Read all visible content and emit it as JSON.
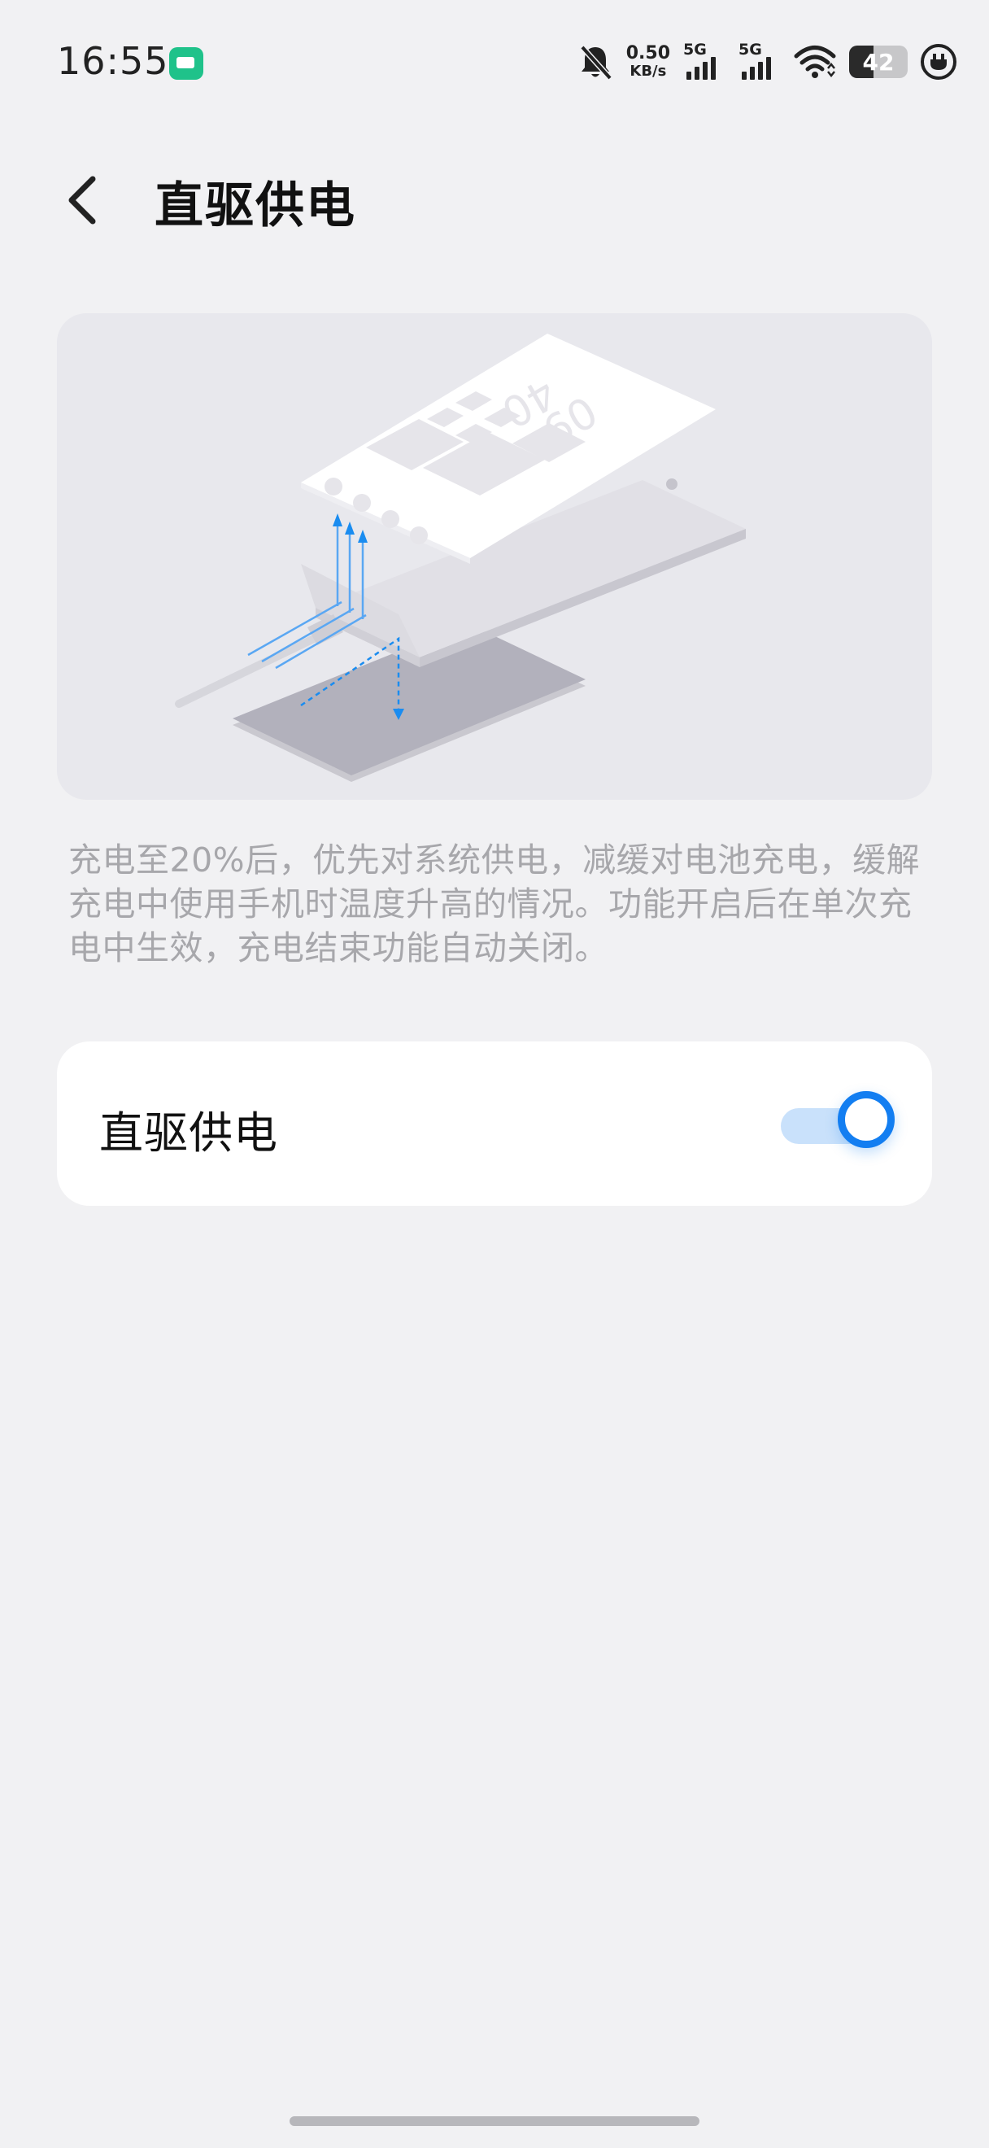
{
  "status_bar": {
    "time": "16:55",
    "net_speed_value": "0.50",
    "net_speed_unit": "KB/s",
    "signal1_label": "5G",
    "signal2_label": "5G",
    "battery_level": "42",
    "battery_fraction": 0.42,
    "icons": [
      "app-badge-icon",
      "bell-muted-icon",
      "signal-icon",
      "signal-icon",
      "wifi-icon",
      "battery-icon",
      "charging-icon"
    ]
  },
  "header": {
    "title": "直驱供电",
    "back_icon": "chevron-left-icon"
  },
  "illustration": {
    "phone_clock_text": "09\n40",
    "accent_color": "#1a8cf0"
  },
  "description": "充电至20%后，优先对系统供电，减缓对电池充电，缓解充电中使用手机时温度升高的情况。功能开启后在单次充电中生效，充电结束功能自动关闭。",
  "setting": {
    "label": "直驱供电",
    "enabled": true,
    "toggle_color": "#137ef1"
  }
}
